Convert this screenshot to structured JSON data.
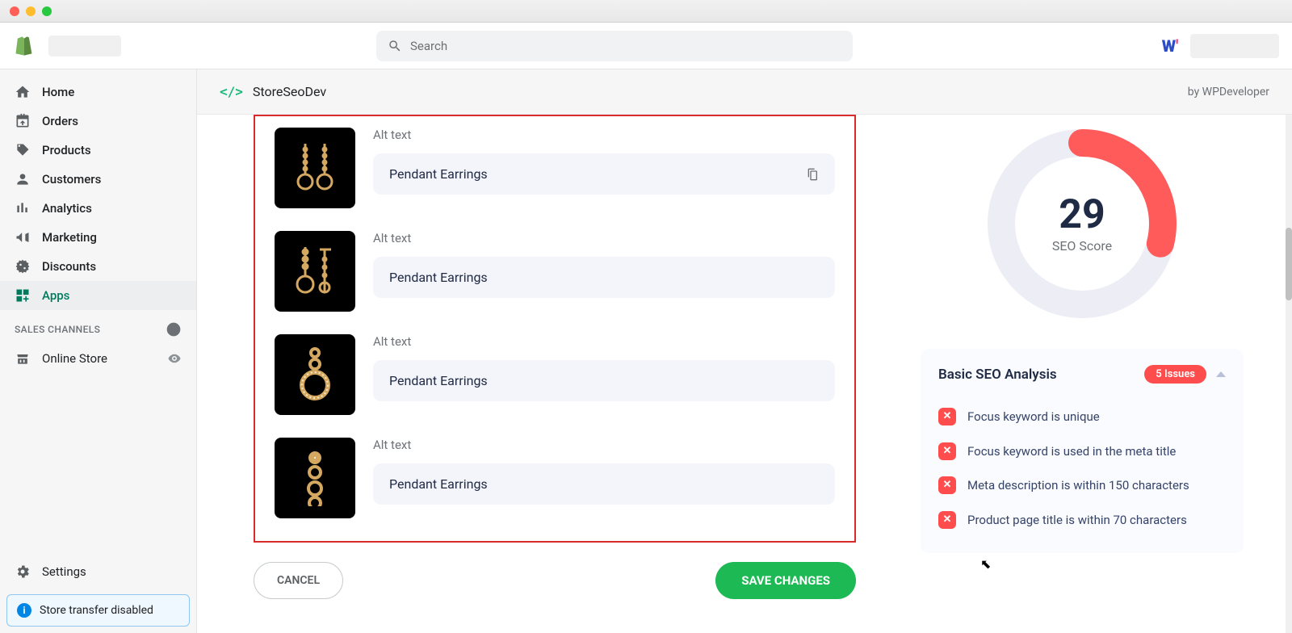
{
  "os": {
    "window_controls": [
      "close",
      "minimize",
      "zoom"
    ]
  },
  "header": {
    "search_placeholder": "Search",
    "wp_logo": "W'"
  },
  "sidebar": {
    "items": [
      {
        "label": "Home",
        "icon": "home-icon"
      },
      {
        "label": "Orders",
        "icon": "orders-icon"
      },
      {
        "label": "Products",
        "icon": "tag-icon"
      },
      {
        "label": "Customers",
        "icon": "person-icon"
      },
      {
        "label": "Analytics",
        "icon": "bars-icon"
      },
      {
        "label": "Marketing",
        "icon": "megaphone-icon"
      },
      {
        "label": "Discounts",
        "icon": "discount-icon"
      },
      {
        "label": "Apps",
        "icon": "apps-icon"
      }
    ],
    "section_label": "SALES CHANNELS",
    "online_store_label": "Online Store",
    "settings_label": "Settings",
    "transfer_banner": "Store transfer disabled"
  },
  "app": {
    "name": "StoreSeoDev",
    "vendor": "by WPDeveloper"
  },
  "alt_text": {
    "label": "Alt text",
    "rows": [
      {
        "value": "Pendant Earrings",
        "thumb": "earrings-pair"
      },
      {
        "value": "Pendant Earrings",
        "thumb": "earrings-front-side"
      },
      {
        "value": "Pendant Earrings",
        "thumb": "earrings-ring-closeup"
      },
      {
        "value": "Pendant Earrings",
        "thumb": "earrings-chain-closeup"
      }
    ]
  },
  "actions": {
    "cancel": "CANCEL",
    "save": "SAVE CHANGES"
  },
  "seo": {
    "score": "29",
    "score_label": "SEO Score",
    "panel_title": "Basic SEO Analysis",
    "issues_badge": "5 Issues",
    "issues": [
      "Focus keyword is unique",
      "Focus keyword is used in the meta title",
      "Meta description is within 150 characters",
      "Product page title is within 70 characters"
    ]
  },
  "colors": {
    "accent_green": "#007a5c",
    "save_green": "#1db954",
    "danger": "#ff4d4d",
    "highlight_border": "#d92b2b"
  }
}
